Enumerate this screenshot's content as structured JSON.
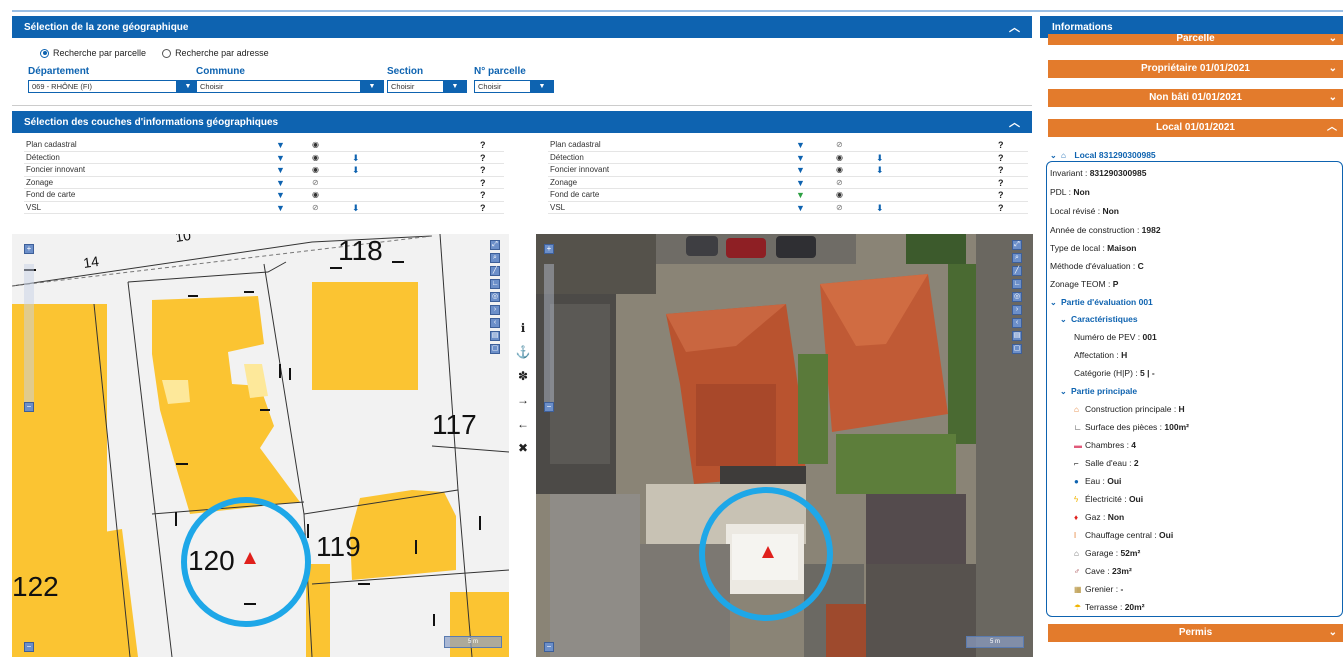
{
  "zone": {
    "title": "Sélection de la zone géographique",
    "radio_parcelle": "Recherche par parcelle",
    "radio_adresse": "Recherche par adresse",
    "departement_label": "Département",
    "departement_value": "069 - RHÔNE (FI)",
    "commune_label": "Commune",
    "commune_value": "Choisir",
    "section_label": "Section",
    "section_value": "Choisir",
    "parcelle_label": "N° parcelle",
    "parcelle_value": "Choisir"
  },
  "couches": {
    "title": "Sélection des couches d'informations géographiques",
    "layers": [
      "Plan cadastral",
      "Détection",
      "Foncier innovant",
      "Zonage",
      "Fond de carte",
      "VSL"
    ],
    "help": "?"
  },
  "map_left": {
    "parcel_labels": [
      "14",
      "10",
      "118",
      "117",
      "120",
      "119",
      "122"
    ],
    "scale": "5 m"
  },
  "map_right": {
    "scale": "5 m"
  },
  "info": {
    "title": "Informations",
    "acc_parcelle": "Parcelle",
    "acc_proprietaire": "Propriétaire 01/01/2021",
    "acc_non_bati": "Non bâti 01/01/2021",
    "acc_local": "Local 01/01/2021",
    "acc_permis": "Permis",
    "local_head": "Local 831290300985",
    "invariant_label": "Invariant : ",
    "invariant_value": "831290300985",
    "pdl_label": "PDL : ",
    "pdl_value": "Non",
    "revise_label": "Local révisé : ",
    "revise_value": "Non",
    "annee_label": "Année de construction : ",
    "annee_value": "1982",
    "type_label": "Type de local : ",
    "type_value": "Maison",
    "methode_label": "Méthode d'évaluation : ",
    "methode_value": "C",
    "teom_label": "Zonage TEOM : ",
    "teom_value": "P",
    "partie_eval": "Partie d'évaluation 001",
    "caracteristiques": "Caractéristiques",
    "pev_label": "Numéro de PEV : ",
    "pev_value": "001",
    "affect_label": "Affectation : ",
    "affect_value": "H",
    "cat_label": "Catégorie (H|P) : ",
    "cat_value": "5 | -",
    "partie_principale": "Partie principale",
    "constr_label": "Construction principale : ",
    "constr_value": "H",
    "surface_label": "Surface des pièces : ",
    "surface_value": "100m²",
    "chambres_label": "Chambres : ",
    "chambres_value": "4",
    "salle_label": "Salle d'eau : ",
    "salle_value": "2",
    "eau_label": "Eau : ",
    "eau_value": "Oui",
    "elec_label": "Électricité : ",
    "elec_value": "Oui",
    "gaz_label": "Gaz : ",
    "gaz_value": "Non",
    "chauff_label": "Chauffage central : ",
    "chauff_value": "Oui",
    "garage_label": "Garage : ",
    "garage_value": "52m²",
    "cave_label": "Cave : ",
    "cave_value": "23m²",
    "grenier_label": "Grenier : ",
    "grenier_value": "-",
    "terrasse_label": "Terrasse : ",
    "terrasse_value": "20m²"
  },
  "colors": {
    "primary": "#0e63b0",
    "accent": "#e37b2c",
    "parcel": "#fbc432",
    "circle": "#1ea7e8",
    "marker": "#e0201c"
  }
}
